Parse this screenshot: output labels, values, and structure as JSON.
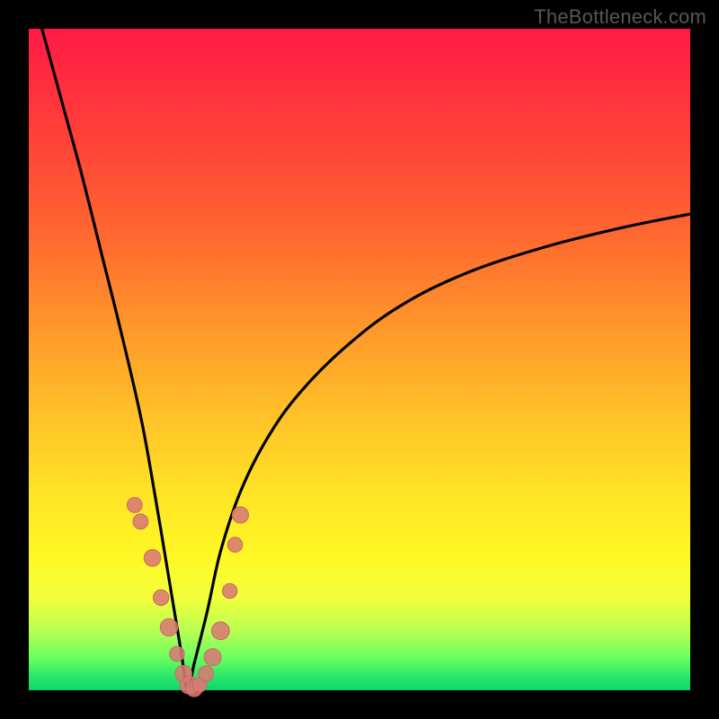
{
  "watermark": "TheBottleneck.com",
  "colors": {
    "frame": "#000000",
    "curve": "#000000",
    "marker_fill": "#d77a74",
    "marker_stroke": "#c96a63"
  },
  "chart_data": {
    "type": "line",
    "title": "",
    "xlabel": "",
    "ylabel": "",
    "xlim": [
      0,
      100
    ],
    "ylim": [
      0,
      100
    ],
    "note": "V-shaped bottleneck curve; y≈100 at x≈0, minimum y≈0 near x≈24, rising to y≈72 at x≈100. Gradient background encodes value (red=high, green=low).",
    "series": [
      {
        "name": "bottleneck-curve",
        "x": [
          2,
          5,
          8,
          11,
          14,
          17,
          19,
          21,
          23,
          24,
          25,
          27,
          29,
          32,
          36,
          41,
          48,
          56,
          66,
          78,
          90,
          100
        ],
        "y": [
          100,
          89,
          78,
          66,
          54,
          41,
          30,
          18,
          6,
          0,
          4,
          12,
          21,
          30,
          38,
          45,
          52,
          58,
          63,
          67,
          70,
          72
        ]
      }
    ],
    "markers": {
      "name": "highlighted-points",
      "x": [
        16.0,
        16.9,
        18.7,
        20.0,
        21.2,
        22.4,
        23.4,
        24.2,
        25.0,
        25.8,
        26.8,
        27.8,
        29.0,
        30.4,
        31.2,
        32.0
      ],
      "y": [
        28.0,
        25.5,
        20.0,
        14.0,
        9.5,
        5.5,
        2.5,
        0.8,
        0.3,
        0.8,
        2.5,
        5.0,
        9.0,
        15.0,
        22.0,
        26.5
      ]
    }
  }
}
